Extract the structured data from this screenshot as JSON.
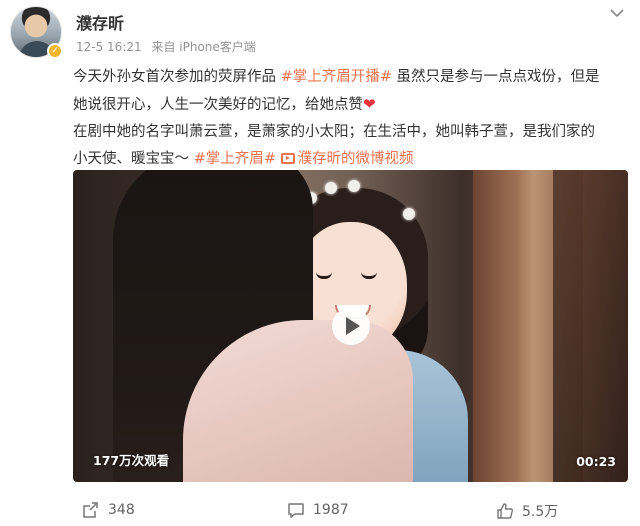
{
  "post": {
    "author": "濮存昕",
    "date": "12-5 16:21",
    "source": "来自 iPhone客户端",
    "lines": [
      {
        "pre": "今天外孙女首次参加的荧屏作品 ",
        "tag": "#掌上齐眉开播#",
        "post": " 虽然只是参与一点点戏份，但是"
      },
      {
        "text": "她说很开心，人生一次美好的记忆，给她点赞",
        "heart": "❤"
      },
      {
        "text": "在剧中她的名字叫萧云萱，是萧家的小太阳；在生活中，她叫韩子萱，是我们家的"
      },
      {
        "pre": "小天使、暖宝宝～ ",
        "tag": "#掌上齐眉#",
        "link": "濮存昕的微博视频"
      }
    ]
  },
  "video": {
    "views": "177万次观看",
    "duration": "00:23"
  },
  "actions": {
    "repost": "348",
    "comment": "1987",
    "like": "5.5万"
  },
  "colors": {
    "accent": "#eb7350",
    "verified": "#f2b42b",
    "heart": "#e8323c"
  }
}
